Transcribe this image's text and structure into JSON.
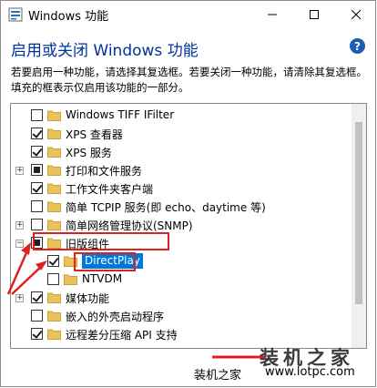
{
  "window": {
    "title": "Windows 功能"
  },
  "heading": "启用或关闭 Windows 功能",
  "description": "若要启用一种功能，请选择其复选框。若要关闭一种功能，请清除其复选框。填充的框表示仅启用该功能的一部分。",
  "features": [
    {
      "label": "Windows TIFF IFilter",
      "state": "unchecked",
      "expander": "",
      "level": 0
    },
    {
      "label": "XPS 查看器",
      "state": "checked",
      "expander": "",
      "level": 0
    },
    {
      "label": "XPS 服务",
      "state": "checked",
      "expander": "",
      "level": 0
    },
    {
      "label": "打印和文件服务",
      "state": "partial",
      "expander": "+",
      "level": 0
    },
    {
      "label": "工作文件夹客户端",
      "state": "checked",
      "expander": "",
      "level": 0
    },
    {
      "label": "简单 TCPIP 服务(即 echo、daytime 等)",
      "state": "unchecked",
      "expander": "",
      "level": 0
    },
    {
      "label": "简单网络管理协议(SNMP)",
      "state": "unchecked",
      "expander": "+",
      "level": 0
    },
    {
      "label": "旧版组件",
      "state": "partial",
      "expander": "-",
      "level": 0
    },
    {
      "label": "DirectPlay",
      "state": "checked",
      "expander": "",
      "level": 1,
      "selected": true
    },
    {
      "label": "NTVDM",
      "state": "unchecked",
      "expander": "",
      "level": 1
    },
    {
      "label": "媒体功能",
      "state": "checked",
      "expander": "+",
      "level": 0
    },
    {
      "label": "嵌入的外壳启动程序",
      "state": "unchecked",
      "expander": "",
      "level": 0
    },
    {
      "label": "远程差分压缩 API 支持",
      "state": "checked",
      "expander": "",
      "level": 0
    }
  ],
  "watermark": {
    "big": "装机之家",
    "small": "装机之家",
    "url": "www.lotpc.com"
  },
  "colors": {
    "heading": "#003399",
    "selection": "#0078d7",
    "highlight_box": "#e02020",
    "folder": "#e8c25a"
  }
}
